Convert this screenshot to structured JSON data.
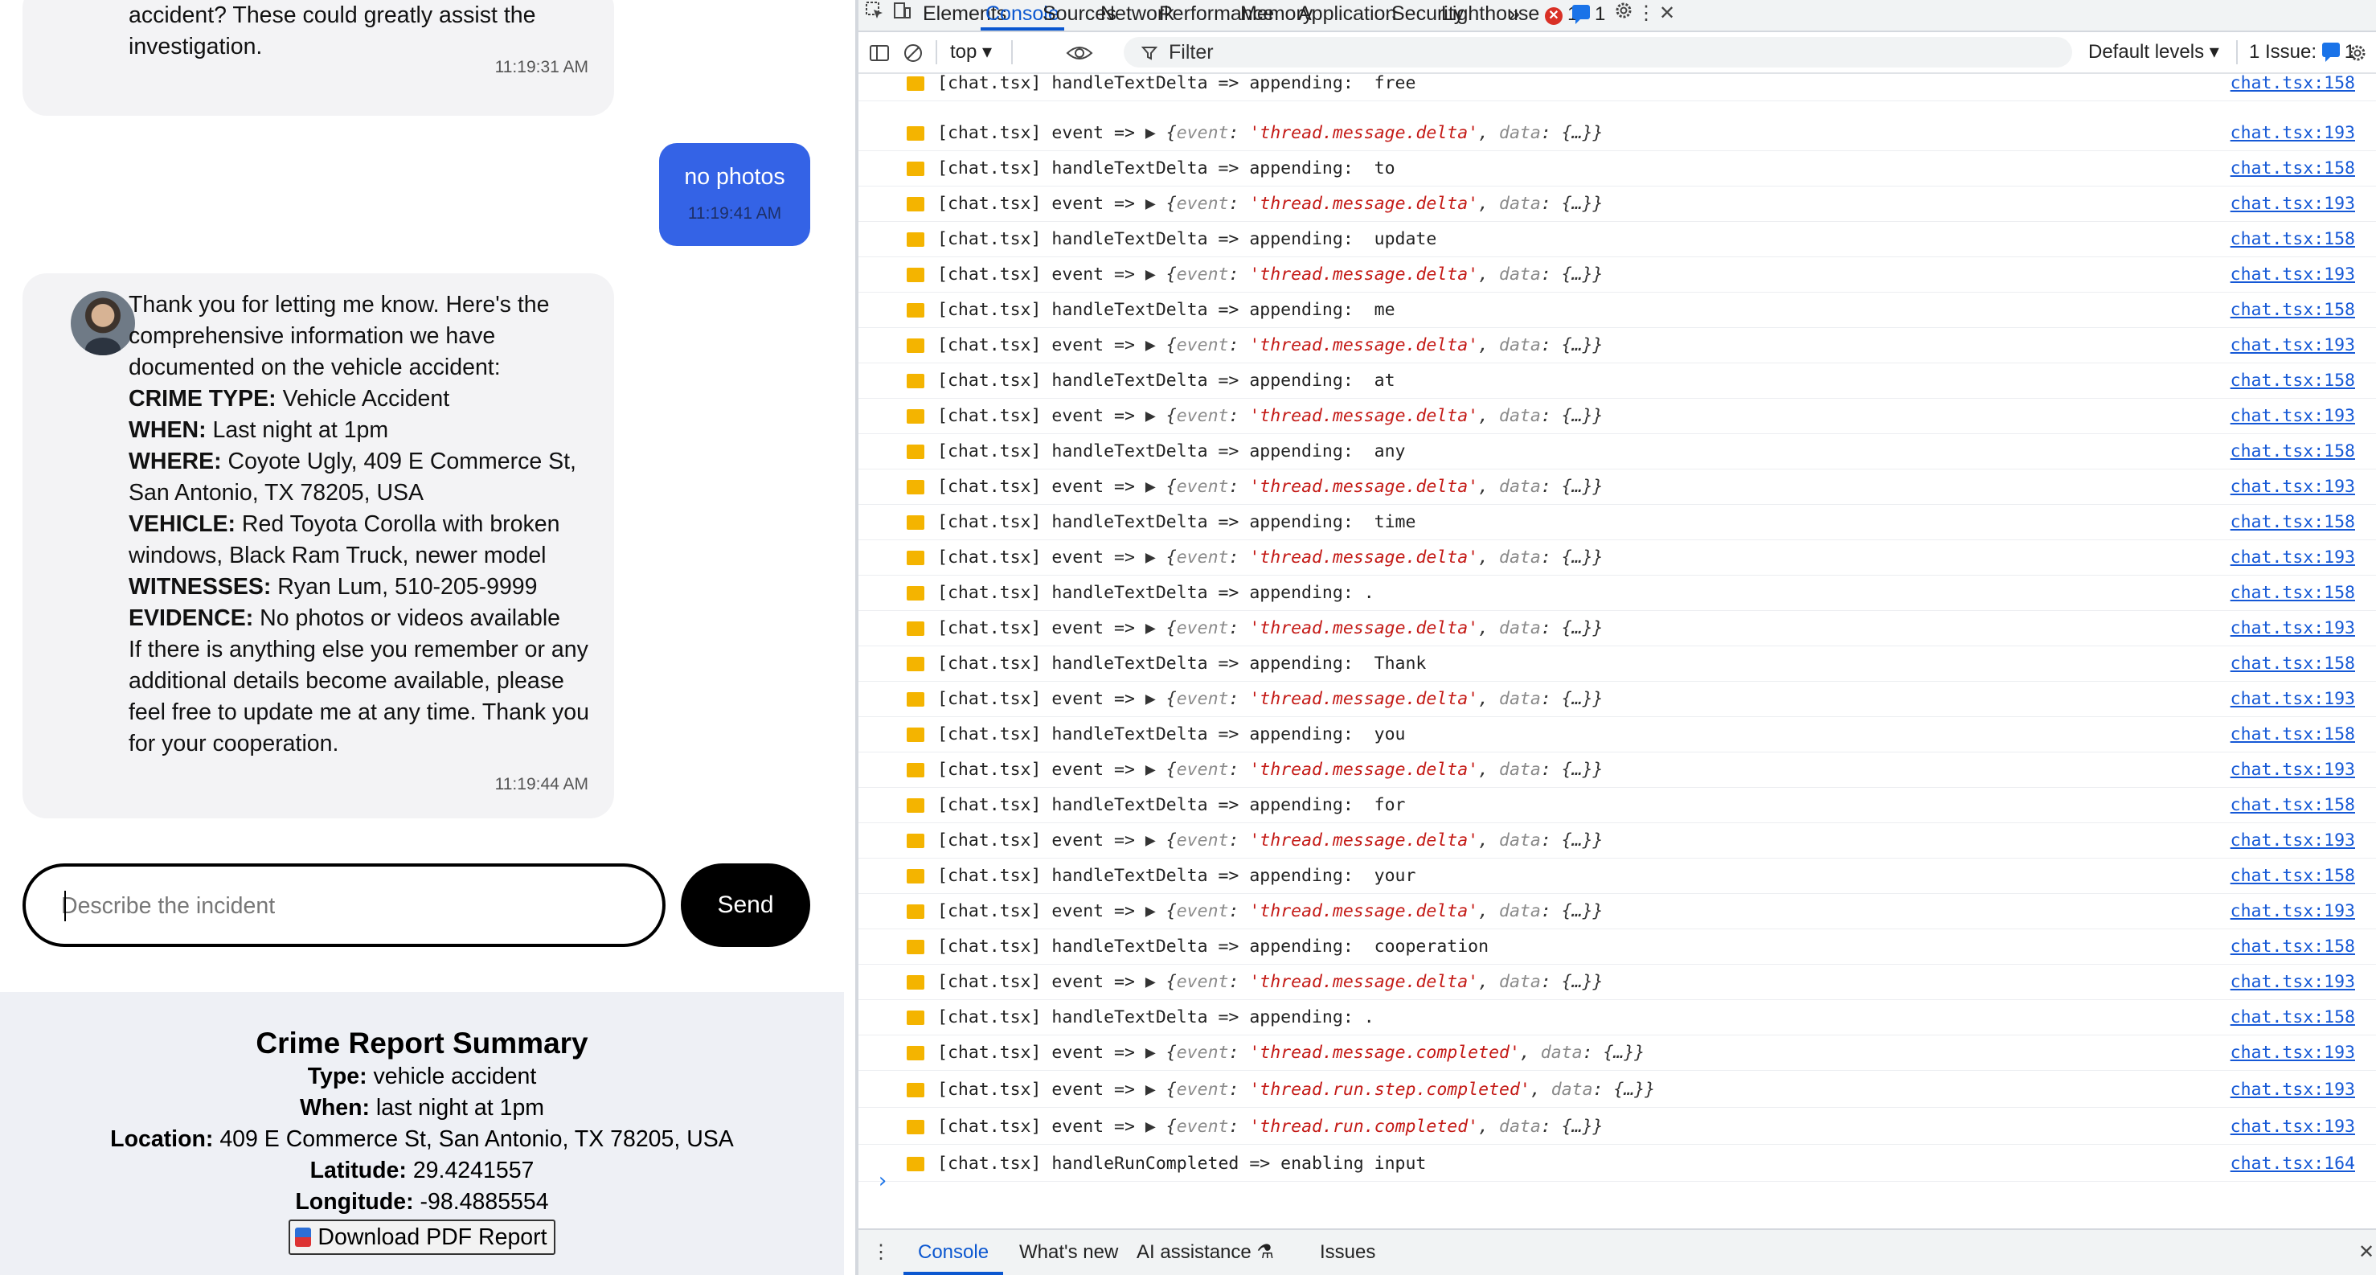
{
  "chat": {
    "msg1": {
      "lines": [
        "accident? These could greatly assist the",
        "investigation."
      ],
      "time": "11:19:31 AM"
    },
    "user_msg": {
      "text": "no photos",
      "time": "11:19:41 AM"
    },
    "msg2": {
      "intro": [
        "Thank you for letting me know. Here's the",
        "comprehensive information we have",
        "documented on the vehicle accident:"
      ],
      "crime_type": {
        "label": "CRIME TYPE:",
        "value": " Vehicle Accident"
      },
      "when": {
        "label": "WHEN:",
        "value": " Last night at 1pm"
      },
      "where": {
        "label": "WHERE:",
        "value": " Coyote Ugly, 409 E Commerce St,",
        "cont": "San Antonio, TX 78205, USA"
      },
      "vehicle": {
        "label": "VEHICLE:",
        "value": " Red Toyota Corolla with broken",
        "cont": "windows, Black Ram Truck, newer model"
      },
      "witnesses": {
        "label": "WITNESSES:",
        "value": " Ryan Lum, 510-205-9999"
      },
      "evidence": {
        "label": "EVIDENCE:",
        "value": " No photos or videos available"
      },
      "outro": [
        "If there is anything else you remember or any",
        "additional details become available, please",
        "feel free to update me at any time. Thank you",
        "for your cooperation."
      ],
      "time": "11:19:44 AM"
    },
    "input_placeholder": "Describe the incident",
    "send_label": "Send"
  },
  "summary": {
    "title": "Crime Report Summary",
    "type": {
      "label": "Type:",
      "value": " vehicle accident"
    },
    "when": {
      "label": "When:",
      "value": " last night at 1pm"
    },
    "location": {
      "label": "Location:",
      "value": " 409 E Commerce St, San Antonio, TX 78205, USA"
    },
    "latitude": {
      "label": "Latitude:",
      "value": " 29.4241557"
    },
    "longitude": {
      "label": "Longitude:",
      "value": " -98.4885554"
    },
    "download_label": "Download PDF Report"
  },
  "devtools": {
    "tabs": [
      "Elements",
      "Console",
      "Sources",
      "Network",
      "Performance",
      "Memory",
      "Application",
      "Security",
      "Lighthouse"
    ],
    "active_tab": "Console",
    "more_tabs": "»",
    "error_count": "1",
    "message_count": "1",
    "toolbar": {
      "context": "top ▾",
      "filter_placeholder": "Filter",
      "levels": "Default levels ▾",
      "issues_label": "1 Issue:",
      "issues_count": "1"
    },
    "logs": [
      {
        "kind": "text",
        "prefix": "[chat.tsx] handleTextDelta => appending:  free",
        "src": "chat.tsx:158"
      },
      {
        "kind": "event",
        "prefix": "[chat.tsx] event => ",
        "event": "'thread.message.delta'",
        "src": "chat.tsx:193"
      },
      {
        "kind": "text",
        "prefix": "[chat.tsx] handleTextDelta => appending:  to",
        "src": "chat.tsx:158"
      },
      {
        "kind": "event",
        "prefix": "[chat.tsx] event => ",
        "event": "'thread.message.delta'",
        "src": "chat.tsx:193"
      },
      {
        "kind": "text",
        "prefix": "[chat.tsx] handleTextDelta => appending:  update",
        "src": "chat.tsx:158"
      },
      {
        "kind": "event",
        "prefix": "[chat.tsx] event => ",
        "event": "'thread.message.delta'",
        "src": "chat.tsx:193"
      },
      {
        "kind": "text",
        "prefix": "[chat.tsx] handleTextDelta => appending:  me",
        "src": "chat.tsx:158"
      },
      {
        "kind": "event",
        "prefix": "[chat.tsx] event => ",
        "event": "'thread.message.delta'",
        "src": "chat.tsx:193"
      },
      {
        "kind": "text",
        "prefix": "[chat.tsx] handleTextDelta => appending:  at",
        "src": "chat.tsx:158"
      },
      {
        "kind": "event",
        "prefix": "[chat.tsx] event => ",
        "event": "'thread.message.delta'",
        "src": "chat.tsx:193"
      },
      {
        "kind": "text",
        "prefix": "[chat.tsx] handleTextDelta => appending:  any",
        "src": "chat.tsx:158"
      },
      {
        "kind": "event",
        "prefix": "[chat.tsx] event => ",
        "event": "'thread.message.delta'",
        "src": "chat.tsx:193"
      },
      {
        "kind": "text",
        "prefix": "[chat.tsx] handleTextDelta => appending:  time",
        "src": "chat.tsx:158"
      },
      {
        "kind": "event",
        "prefix": "[chat.tsx] event => ",
        "event": "'thread.message.delta'",
        "src": "chat.tsx:193"
      },
      {
        "kind": "text",
        "prefix": "[chat.tsx] handleTextDelta => appending: .",
        "src": "chat.tsx:158"
      },
      {
        "kind": "event",
        "prefix": "[chat.tsx] event => ",
        "event": "'thread.message.delta'",
        "src": "chat.tsx:193"
      },
      {
        "kind": "text",
        "prefix": "[chat.tsx] handleTextDelta => appending:  Thank",
        "src": "chat.tsx:158"
      },
      {
        "kind": "event",
        "prefix": "[chat.tsx] event => ",
        "event": "'thread.message.delta'",
        "src": "chat.tsx:193"
      },
      {
        "kind": "text",
        "prefix": "[chat.tsx] handleTextDelta => appending:  you",
        "src": "chat.tsx:158"
      },
      {
        "kind": "event",
        "prefix": "[chat.tsx] event => ",
        "event": "'thread.message.delta'",
        "src": "chat.tsx:193"
      },
      {
        "kind": "text",
        "prefix": "[chat.tsx] handleTextDelta => appending:  for",
        "src": "chat.tsx:158"
      },
      {
        "kind": "event",
        "prefix": "[chat.tsx] event => ",
        "event": "'thread.message.delta'",
        "src": "chat.tsx:193"
      },
      {
        "kind": "text",
        "prefix": "[chat.tsx] handleTextDelta => appending:  your",
        "src": "chat.tsx:158"
      },
      {
        "kind": "event",
        "prefix": "[chat.tsx] event => ",
        "event": "'thread.message.delta'",
        "src": "chat.tsx:193"
      },
      {
        "kind": "text",
        "prefix": "[chat.tsx] handleTextDelta => appending:  cooperation",
        "src": "chat.tsx:158"
      },
      {
        "kind": "event",
        "prefix": "[chat.tsx] event => ",
        "event": "'thread.message.delta'",
        "src": "chat.tsx:193"
      },
      {
        "kind": "text",
        "prefix": "[chat.tsx] handleTextDelta => appending: .",
        "src": "chat.tsx:158"
      },
      {
        "kind": "event",
        "prefix": "[chat.tsx] event => ",
        "event": "'thread.message.completed'",
        "src": "chat.tsx:193"
      },
      {
        "kind": "event",
        "prefix": "[chat.tsx] event => ",
        "event": "'thread.run.step.completed'",
        "src": "chat.tsx:193"
      },
      {
        "kind": "event",
        "prefix": "[chat.tsx] event => ",
        "event": "'thread.run.completed'",
        "src": "chat.tsx:193"
      },
      {
        "kind": "text",
        "prefix": "[chat.tsx] handleRunCompleted => enabling input",
        "src": "chat.tsx:164"
      }
    ],
    "drawer_tabs": [
      "Console",
      "What's new",
      "AI assistance",
      "Issues"
    ],
    "drawer_active": "Console"
  },
  "icons": {
    "inspect": "inspect-element-icon",
    "device": "device-toolbar-icon",
    "settings": "gear-icon",
    "kebab": "more-vertical-icon",
    "sidebar": "sidebar-toggle-icon",
    "clear": "clear-console-icon",
    "eye": "live-expression-eye-icon",
    "filter": "filter-funnel-icon",
    "flask": "flask-icon"
  },
  "colors": {
    "user_bubble": "#3463e6",
    "bot_bubble": "#f3f3f5",
    "devtools_accent": "#0b57d0",
    "warn_marker": "#f4b400",
    "event_string": "#c41a16"
  }
}
